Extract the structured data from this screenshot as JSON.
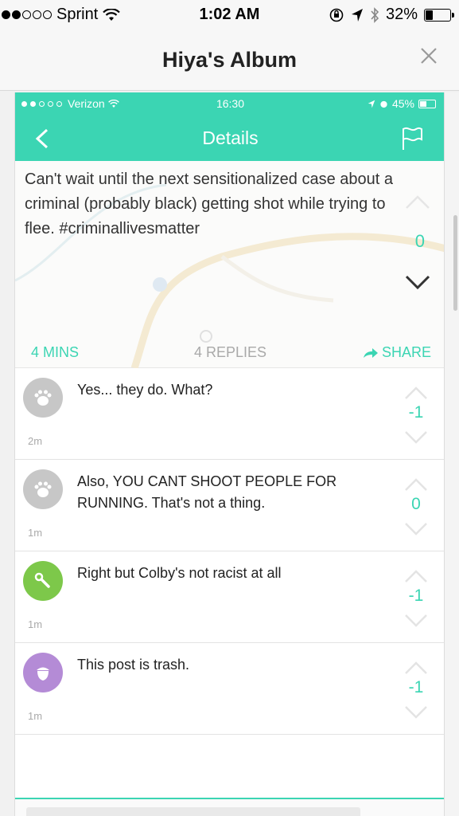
{
  "os_status": {
    "carrier": "Sprint",
    "time": "1:02 AM",
    "battery": "32%",
    "battery_level": 0.32
  },
  "album": {
    "title": "Hiya's Album"
  },
  "inner_status": {
    "carrier": "Verizon",
    "time": "16:30",
    "battery": "45%",
    "battery_level": 0.45
  },
  "inner_nav": {
    "title": "Details"
  },
  "post": {
    "text": "Can't wait until the next sensitionalized case about a criminal (probably black) getting shot while trying to flee. #criminallivesmatter",
    "votes": "0",
    "age": "4 MINS",
    "replies": "4 REPLIES",
    "share": "SHARE"
  },
  "replies": [
    {
      "text": "Yes... they do. What?",
      "time": "2m",
      "votes": "-1",
      "avatar_color": "#c7c7c7",
      "icon": "paw-icon"
    },
    {
      "text": "Also, YOU CANT SHOOT PEOPLE FOR RUNNING. That's not a thing.",
      "time": "1m",
      "votes": "0",
      "avatar_color": "#c7c7c7",
      "icon": "paw-icon"
    },
    {
      "text": "Right but Colby's not racist at all",
      "time": "1m",
      "votes": "-1",
      "avatar_color": "#7dc84a",
      "icon": "wrench-icon"
    },
    {
      "text": "This post is trash.",
      "time": "1m",
      "votes": "-1",
      "avatar_color": "#b48bd6",
      "icon": "acorn-icon"
    }
  ],
  "colors": {
    "accent": "#3bd5b3"
  }
}
